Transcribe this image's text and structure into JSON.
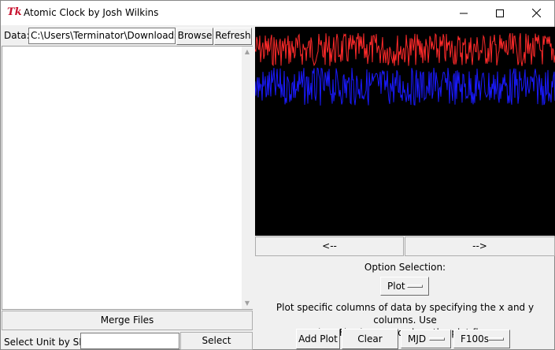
{
  "window": {
    "title": "Atomic Clock by Josh Wilkins",
    "icon": "tk-feather-icon",
    "minimize": "—",
    "maximize": "☐",
    "close": "✕"
  },
  "data_row": {
    "label": "Data:",
    "path_value": "C:\\Users\\Terminator\\Downloads\\A",
    "browse_label": "Browse",
    "refresh_label": "Refresh"
  },
  "file_list": {
    "items": []
  },
  "merge_label": "Merge Files",
  "sn_row": {
    "label": "Select Unit by SN:",
    "value": "",
    "select_label": "Select"
  },
  "plot": {
    "background": "#000000",
    "series": [
      {
        "color": "#ff2a2a"
      },
      {
        "color": "#1a1aff"
      }
    ]
  },
  "nav": {
    "prev_label": "<--",
    "next_label": "-->"
  },
  "options": {
    "label": "Option Selection:",
    "mode_value": "Plot",
    "description_line1": "Plot specific columns of data by specifying the x and y columns. Use",
    "description_line2": "\"Clear Fig\" button to clear the plot figure.",
    "add_plot_label": "Add Plot",
    "clear_figure_label": "Clear Figure",
    "x_column_value": "MJD",
    "y_column_value": "F100s"
  }
}
